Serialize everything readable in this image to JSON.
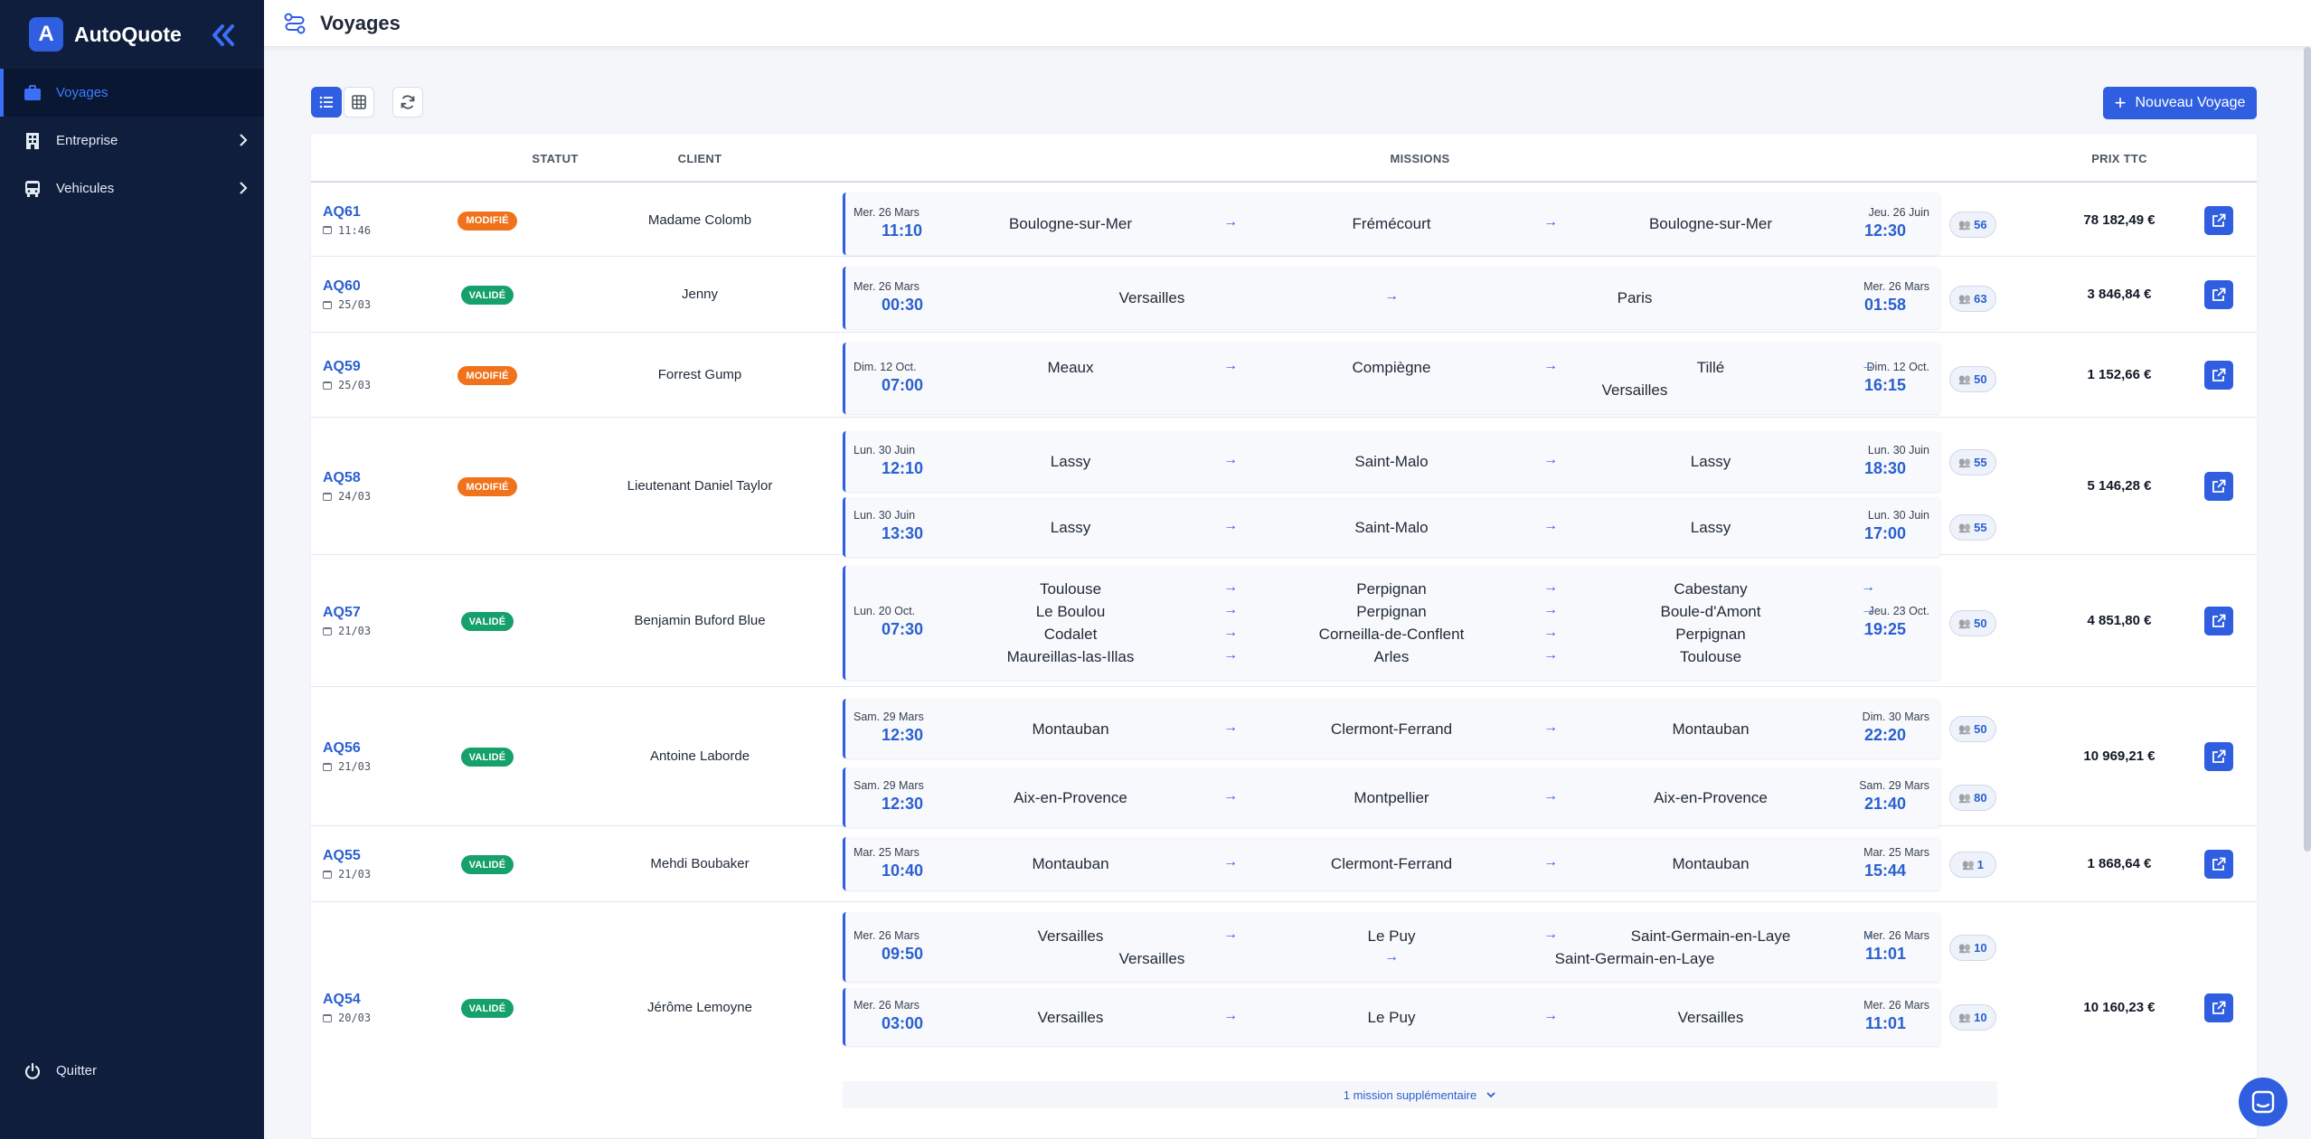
{
  "app": {
    "name": "AutoQuote",
    "logo_letter": "A"
  },
  "sidebar": {
    "items": [
      {
        "label": "Voyages",
        "icon": "briefcase-icon",
        "active": true
      },
      {
        "label": "Entreprise",
        "icon": "building-icon"
      },
      {
        "label": "Vehicules",
        "icon": "bus-icon"
      }
    ],
    "quit_label": "Quitter"
  },
  "header": {
    "title": "Voyages"
  },
  "toolbar": {
    "new_label": "Nouveau Voyage"
  },
  "table": {
    "headers": {
      "statut": "STATUT",
      "client": "CLIENT",
      "missions": "MISSIONS",
      "prix": "PRIX TTC"
    },
    "rows": [
      {
        "id": "AQ61",
        "date": "11:46",
        "status": "MODIFIÉ",
        "client": "Madame Colomb",
        "price": "78 182,49 €",
        "missions": [
          {
            "start_date": "Mer. 26 Mars",
            "start_time": "11:10",
            "end_date": "Jeu. 26 Juin",
            "end_time": "12:30",
            "pax": "56",
            "lines": [
              [
                "Boulogne-sur-Mer",
                "Frémécourt",
                "Boulogne-sur-Mer"
              ]
            ]
          }
        ]
      },
      {
        "id": "AQ60",
        "date": "25/03",
        "status": "VALIDÉ",
        "client": "Jenny",
        "price": "3 846,84 €",
        "missions": [
          {
            "start_date": "Mer. 26 Mars",
            "start_time": "00:30",
            "end_date": "Mer. 26 Mars",
            "end_time": "01:58",
            "pax": "63",
            "lines": [
              [
                "Versailles",
                "Paris"
              ]
            ]
          }
        ]
      },
      {
        "id": "AQ59",
        "date": "25/03",
        "status": "MODIFIÉ",
        "client": "Forrest Gump",
        "price": "1 152,66 €",
        "missions": [
          {
            "start_date": "Dim. 12 Oct.",
            "start_time": "07:00",
            "end_date": "Dim. 12 Oct.",
            "end_time": "16:15",
            "pax": "50",
            "lines": [
              [
                "Meaux",
                "Compiègne",
                "Tillé",
                ""
              ],
              [
                "",
                "Versailles"
              ]
            ]
          }
        ]
      },
      {
        "id": "AQ58",
        "date": "24/03",
        "status": "MODIFIÉ",
        "client": "Lieutenant Daniel Taylor",
        "price": "5 146,28 €",
        "missions": [
          {
            "start_date": "Lun. 30 Juin",
            "start_time": "12:10",
            "end_date": "Lun. 30 Juin",
            "end_time": "18:30",
            "pax": "55",
            "lines": [
              [
                "Lassy",
                "Saint-Malo",
                "Lassy"
              ]
            ]
          },
          {
            "start_date": "Lun. 30 Juin",
            "start_time": "13:30",
            "end_date": "Lun. 30 Juin",
            "end_time": "17:00",
            "pax": "55",
            "lines": [
              [
                "Lassy",
                "Saint-Malo",
                "Lassy"
              ]
            ]
          }
        ]
      },
      {
        "id": "AQ57",
        "date": "21/03",
        "status": "VALIDÉ",
        "client": "Benjamin Buford Blue",
        "price": "4 851,80 €",
        "missions": [
          {
            "start_date": "Lun. 20 Oct.",
            "start_time": "07:30",
            "end_date": "Jeu. 23 Oct.",
            "end_time": "19:25",
            "pax": "50",
            "lines": [
              [
                "Toulouse",
                "Perpignan",
                "Cabestany",
                ""
              ],
              [
                "Le Boulou",
                "Perpignan",
                "Boule-d'Amont",
                ""
              ],
              [
                "Codalet",
                "Corneilla-de-Conflent",
                "Perpignan",
                ""
              ],
              [
                "Maureillas-las-Illas",
                "Arles",
                "Toulouse"
              ]
            ]
          }
        ]
      },
      {
        "id": "AQ56",
        "date": "21/03",
        "status": "VALIDÉ",
        "client": "Antoine Laborde",
        "price": "10 969,21 €",
        "missions": [
          {
            "start_date": "Sam. 29 Mars",
            "start_time": "12:30",
            "end_date": "Dim. 30 Mars",
            "end_time": "22:20",
            "pax": "50",
            "lines": [
              [
                "Montauban",
                "Clermont-Ferrand",
                "Montauban"
              ]
            ]
          },
          {
            "start_date": "Sam. 29 Mars",
            "start_time": "12:30",
            "end_date": "Sam. 29 Mars",
            "end_time": "21:40",
            "pax": "80",
            "lines": [
              [
                "Aix-en-Provence",
                "Montpellier",
                "Aix-en-Provence"
              ]
            ]
          }
        ]
      },
      {
        "id": "AQ55",
        "date": "21/03",
        "status": "VALIDÉ",
        "client": "Mehdi Boubaker",
        "price": "1 868,64 €",
        "missions": [
          {
            "start_date": "Mar. 25 Mars",
            "start_time": "10:40",
            "end_date": "Mar. 25 Mars",
            "end_time": "15:44",
            "pax": "1",
            "lines": [
              [
                "Montauban",
                "Clermont-Ferrand",
                "Montauban"
              ]
            ]
          }
        ]
      },
      {
        "id": "AQ54",
        "date": "20/03",
        "status": "VALIDÉ",
        "client": "Jérôme Lemoyne",
        "price": "10 160,23 €",
        "missions": [
          {
            "start_date": "Mer. 26 Mars",
            "start_time": "09:50",
            "end_date": "Mer. 26 Mars",
            "end_time": "11:01",
            "pax": "10",
            "lines": [
              [
                "Versailles",
                "Le Puy",
                "Saint-Germain-en-Laye",
                ""
              ],
              [
                "Versailles",
                "Saint-Germain-en-Laye"
              ]
            ]
          },
          {
            "start_date": "Mer. 26 Mars",
            "start_time": "03:00",
            "end_date": "Mer. 26 Mars",
            "end_time": "11:01",
            "pax": "10",
            "lines": [
              [
                "Versailles",
                "Le Puy",
                "Versailles"
              ]
            ]
          }
        ],
        "more_label": "1 mission supplémentaire"
      }
    ]
  }
}
